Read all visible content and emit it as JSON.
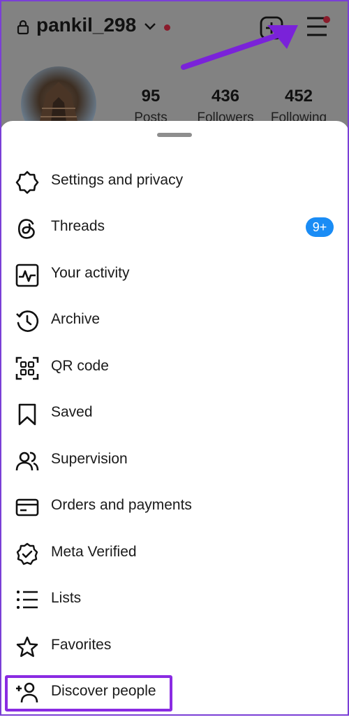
{
  "header": {
    "username": "pankil_298"
  },
  "profile": {
    "stats": [
      {
        "value": "95",
        "label": "Posts"
      },
      {
        "value": "436",
        "label": "Followers"
      },
      {
        "value": "452",
        "label": "Following"
      }
    ]
  },
  "menu": {
    "items": [
      {
        "label": "Settings and privacy",
        "icon": "settings-icon"
      },
      {
        "label": "Threads",
        "icon": "threads-icon",
        "badge": "9+"
      },
      {
        "label": "Your activity",
        "icon": "activity-icon"
      },
      {
        "label": "Archive",
        "icon": "archive-icon"
      },
      {
        "label": "QR code",
        "icon": "qr-code-icon"
      },
      {
        "label": "Saved",
        "icon": "bookmark-icon"
      },
      {
        "label": "Supervision",
        "icon": "supervision-icon"
      },
      {
        "label": "Orders and payments",
        "icon": "card-icon"
      },
      {
        "label": "Meta Verified",
        "icon": "verified-icon"
      },
      {
        "label": "Lists",
        "icon": "lists-icon"
      },
      {
        "label": "Favorites",
        "icon": "star-icon"
      },
      {
        "label": "Discover people",
        "icon": "add-person-icon"
      }
    ]
  },
  "colors": {
    "badge": "#1a8cf5",
    "highlight": "#8a2be2",
    "notification_dot": "#8a1b2b"
  }
}
